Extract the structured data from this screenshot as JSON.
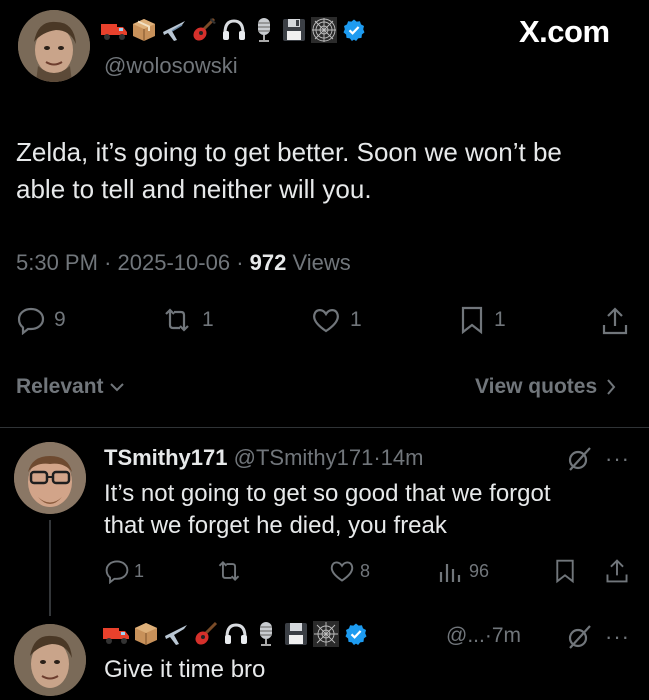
{
  "author": {
    "handle": "@wolosowski",
    "badge_icons": [
      "truck",
      "package",
      "airplane",
      "guitar",
      "headphones",
      "microphone",
      "floppy-disk",
      "spider-web",
      "verified-badge"
    ]
  },
  "site_label": "X.com",
  "post": {
    "text_line1": "Zelda, it’s going to get better. Soon we won’t be",
    "text_line2": "able to tell and neither will you.",
    "time": "5:30 PM",
    "date": "2025-10-06",
    "views_count": "972",
    "views_label": "Views",
    "dot": "·",
    "actions": {
      "replies": "9",
      "reposts": "1",
      "likes": "1",
      "bookmarks": "1"
    }
  },
  "filter": {
    "sort_label": "Relevant",
    "view_quotes_label": "View quotes"
  },
  "replies": [
    {
      "display_name": "TSmithy171",
      "handle": "@TSmithy171",
      "time": "14m",
      "text_line1": "It’s not going to get so good that we forgot",
      "text_line2": "that we forget he died, you freak",
      "actions": {
        "replies": "1",
        "likes": "8",
        "views": "96"
      }
    },
    {
      "handle_short": "@...",
      "time": "7m",
      "text": "Give it time bro"
    }
  ],
  "colors": {
    "background": "#000000",
    "text": "#e7e9ea",
    "muted": "#71767b",
    "verified": "#1d9bf0",
    "divider": "#2f3336"
  }
}
